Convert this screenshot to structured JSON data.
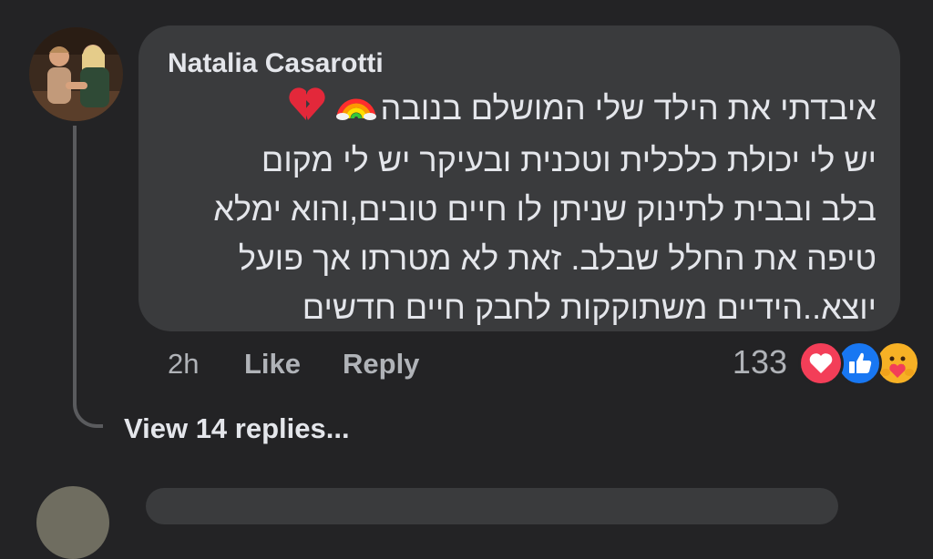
{
  "comment": {
    "author": "Natalia Casarotti",
    "lines": [
      "איבדתי את הילד שלי המושלם בנובה",
      "יש לי יכולת כלכלית וטכנית ובעיקר יש לי מקום",
      "בלב ובבית לתינוק שניתן לו חיים טובים,והוא ימלא",
      "טיפה את החלל שבלב. זאת לא מטרתו אך פועל",
      "יוצא..הידיים משתוקקות לחבק חיים חדשים"
    ],
    "emojis": [
      "rainbow-emoji",
      "broken-heart-emoji"
    ],
    "time": "2h",
    "like_label": "Like",
    "reply_label": "Reply",
    "reaction_count": "133",
    "reactions": [
      "love-reaction",
      "like-reaction",
      "care-reaction"
    ]
  },
  "replies": {
    "view_label": "View 14 replies..."
  },
  "colors": {
    "background": "#232325",
    "bubble": "#3a3b3d",
    "text": "#e4e6eb",
    "muted": "#b0b3b8",
    "like_blue": "#1877f2",
    "love_red": "#f33e58",
    "care_yellow": "#f7b125"
  }
}
